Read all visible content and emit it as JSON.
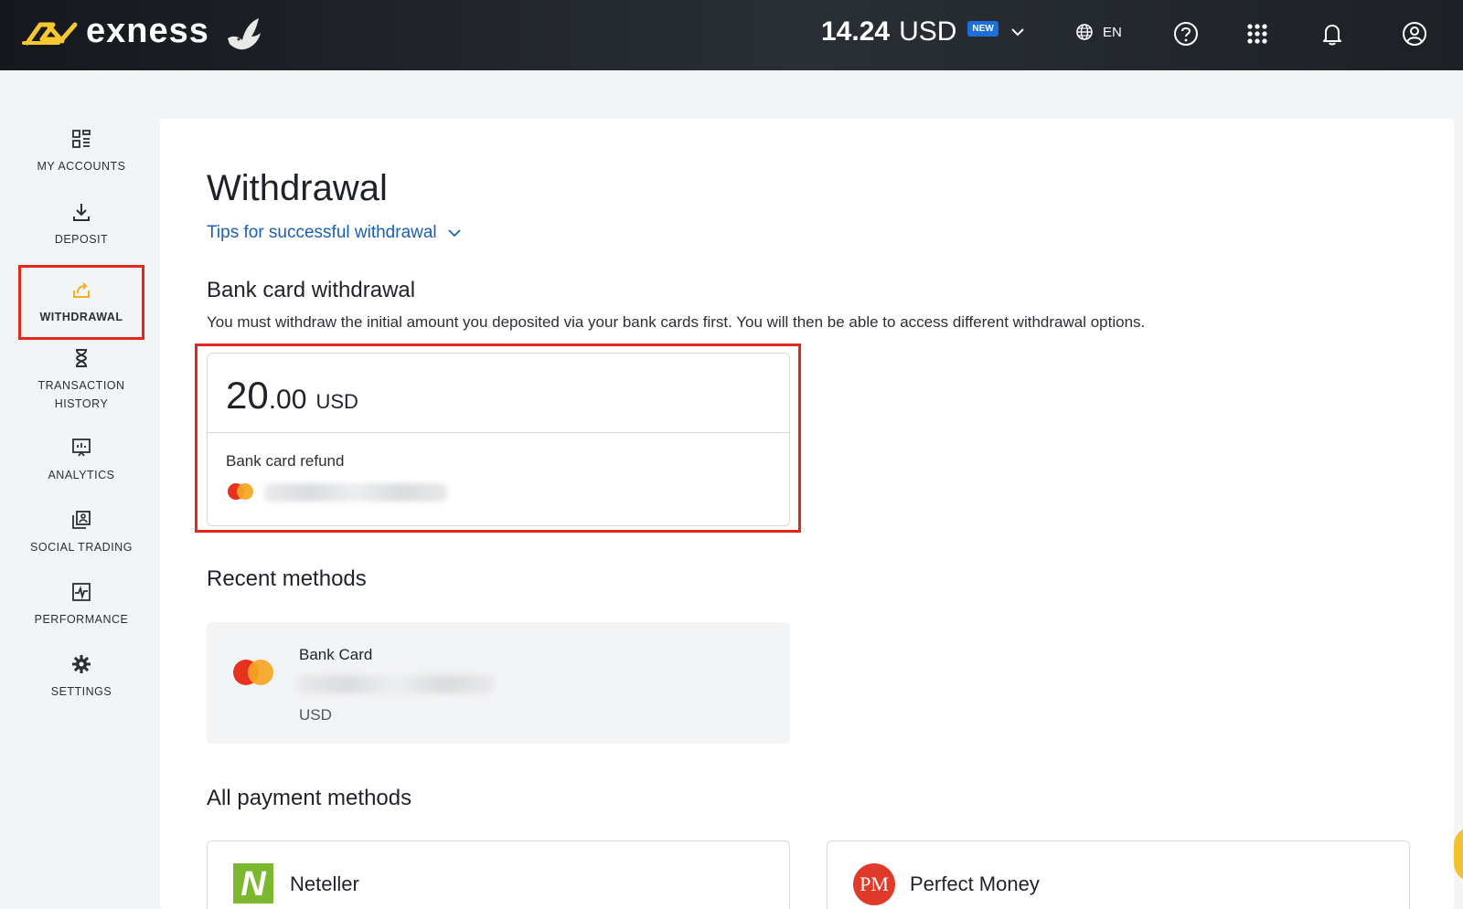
{
  "header": {
    "brand": "exness",
    "balance_amount": "14.24",
    "balance_currency": "USD",
    "new_badge": "NEW",
    "language": "EN",
    "colors": {
      "accent": "#f7c731",
      "header_bg": "#1d2126"
    }
  },
  "sidebar": {
    "items": [
      {
        "label": "MY ACCOUNTS",
        "icon": "dashboard-icon"
      },
      {
        "label": "DEPOSIT",
        "icon": "download-icon"
      },
      {
        "label": "WITHDRAWAL",
        "icon": "withdraw-icon",
        "active": true
      },
      {
        "label": "TRANSACTION HISTORY",
        "icon": "hourglass-icon"
      },
      {
        "label": "ANALYTICS",
        "icon": "chart-board-icon"
      },
      {
        "label": "SOCIAL TRADING",
        "icon": "social-trading-icon"
      },
      {
        "label": "PERFORMANCE",
        "icon": "performance-icon"
      },
      {
        "label": "SETTINGS",
        "icon": "gear-icon"
      }
    ]
  },
  "main": {
    "title": "Withdrawal",
    "tips_link": "Tips for successful withdrawal",
    "bank_card_section": {
      "title": "Bank card withdrawal",
      "description": "You must withdraw the initial amount you deposited via your bank cards first. You will then be able to access different withdrawal options.",
      "amount_integer": "20",
      "amount_decimal": ".00",
      "amount_currency": "USD",
      "refund_label": "Bank card refund"
    },
    "recent_section": {
      "title": "Recent methods",
      "method_name": "Bank Card",
      "method_currency": "USD"
    },
    "all_methods_section": {
      "title": "All payment methods",
      "methods": [
        {
          "name": "Neteller",
          "logo_text": "N"
        },
        {
          "name": "Perfect Money",
          "logo_text": "PM"
        }
      ]
    }
  }
}
